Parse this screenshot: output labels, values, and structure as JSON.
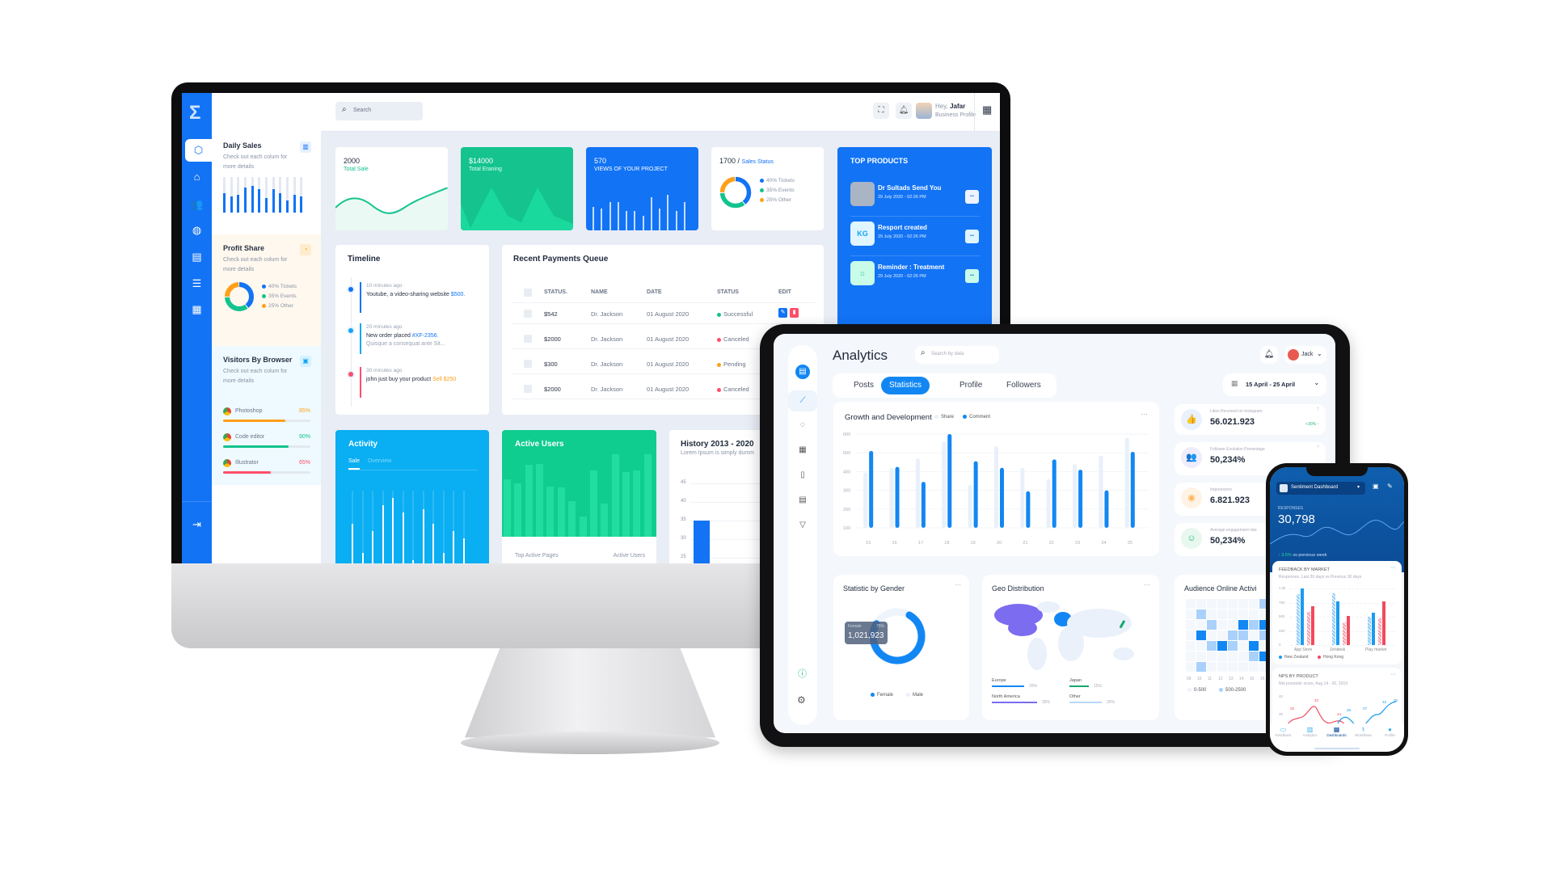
{
  "monitor": {
    "sidebar_icons": [
      "cube-icon",
      "home-icon",
      "users-icon",
      "globe-icon",
      "document-icon",
      "server-icon",
      "grid-icon"
    ],
    "logout_icon": "logout-icon",
    "search": {
      "placeholder": "Search"
    },
    "user": {
      "greeting": "Hey,",
      "name": "Jafar",
      "role": "Business Profile"
    },
    "panel": {
      "daily_sales": {
        "title": "Daily Sales",
        "desc": "Check out each colum for more details",
        "bars": [
          0.55,
          0.45,
          0.5,
          0.7,
          0.75,
          0.65,
          0.4,
          0.65,
          0.55,
          0.35,
          0.5,
          0.45
        ]
      },
      "profit_share": {
        "title": "Profit Share",
        "desc": "Check out each colum for more details",
        "legend": [
          {
            "label": "40% Tickets",
            "value": 40,
            "color": "#1273f5"
          },
          {
            "label": "35% Events",
            "value": 35,
            "color": "#14c38e"
          },
          {
            "label": "25% Other",
            "value": 25,
            "color": "#ff9f1a"
          }
        ]
      },
      "visitors": {
        "title": "Visitors By Browser",
        "desc": "Check out each colum for more details",
        "items": [
          {
            "name": "Photoshop",
            "pct": "85%",
            "value": 85,
            "color": "#ff9f1a"
          },
          {
            "name": "Code editor",
            "pct": "90%",
            "value": 90,
            "color": "#14c38e"
          },
          {
            "name": "Illustrator",
            "pct": "65%",
            "value": 65,
            "color": "#ff4d6a"
          }
        ]
      }
    },
    "cards": {
      "total_sale": {
        "value": "2000",
        "label": "Total Sale"
      },
      "total_earning": {
        "value": "$14000",
        "label": "Total Eraning"
      },
      "views": {
        "value": "570",
        "label": "VIEWS OF YOUR PROJECT",
        "bars": [
          0.5,
          0.45,
          0.6,
          0.6,
          0.4,
          0.4,
          0.3,
          0.7,
          0.45,
          0.75,
          0.4,
          0.6
        ]
      },
      "sales_status": {
        "value": "1700 /",
        "label": "Sales Status",
        "legend": [
          {
            "label": "40% Tickets",
            "value": 40,
            "color": "#1273f5"
          },
          {
            "label": "35% Events",
            "value": 35,
            "color": "#14c38e"
          },
          {
            "label": "25% Other",
            "value": 25,
            "color": "#ff9f1a"
          }
        ]
      }
    },
    "top_products": {
      "title": "TOP PRODUCTS",
      "items": [
        {
          "title": "Dr Sultads Send You",
          "date": "29 July 2020 - 02:26 PM",
          "badge": ""
        },
        {
          "title": "Resport created",
          "date": "29 July 2020 - 02:26 PM",
          "badge": "KG"
        },
        {
          "title": "Reminder : Treatment",
          "date": "29 July 2020 - 02:26 PM",
          "badge": "⌂"
        }
      ],
      "more": "•••"
    },
    "timeline": {
      "title": "Timeline",
      "items": [
        {
          "time": "10 minutes ago",
          "text": "Youtube, a video-sharing website",
          "highlight": "$500.",
          "sub": "",
          "color": "#1273f5"
        },
        {
          "time": "20 minutes ago",
          "text": "New order placed",
          "highlight": "#XF-2356.",
          "sub": "Quisque a consequat ante Sit...",
          "color": "#12a5f0"
        },
        {
          "time": "30 minutes ago",
          "text": "john just buy your product",
          "highlight": "Sell $250",
          "sub": "",
          "color": "#ff4d6a"
        }
      ]
    },
    "payments": {
      "title": "Recent Payments Queue",
      "columns": [
        "STATUS.",
        "NAME",
        "DATE",
        "STATUS",
        "EDIT"
      ],
      "rows": [
        {
          "amount": "$542",
          "name": "Dr. Jackson",
          "date": "01 August 2020",
          "status": "Successful",
          "color": "#14c38e"
        },
        {
          "amount": "$2000",
          "name": "Dr. Jackson",
          "date": "01 August 2020",
          "status": "Canceled",
          "color": "#ff4d6a"
        },
        {
          "amount": "$300",
          "name": "Dr. Jackson",
          "date": "01 August 2020",
          "status": "Pending",
          "color": "#ff9f1a"
        },
        {
          "amount": "$2000",
          "name": "Dr. Jackson",
          "date": "01 August 2020",
          "status": "Canceled",
          "color": "#ff4d6a"
        }
      ]
    },
    "activity": {
      "title": "Activity",
      "tabs": [
        "Sale",
        "Overview"
      ],
      "bars": [
        0.55,
        0.15,
        0.45,
        0.8,
        0.9,
        0.7,
        0.05,
        0.75,
        0.55,
        0.15,
        0.45,
        0.35
      ]
    },
    "active_users": {
      "title": "Active Users",
      "bars": [
        0.7,
        0.65,
        0.87,
        0.88,
        0.61,
        0.6,
        0.43,
        0.25,
        0.8,
        0.4,
        1.0,
        0.78,
        0.8,
        1.0
      ],
      "footer_left": "Top Active Pages",
      "footer_right": "Active Users"
    },
    "history": {
      "title": "History 2013 - 2020",
      "desc": "Lorem Ipsum is simply dumm",
      "yticks": [
        "45",
        "40",
        "35",
        "30",
        "25"
      ],
      "bar_value": 35
    }
  },
  "tablet": {
    "title": "Analytics",
    "search_placeholder": "Search by data",
    "user": "Jack",
    "tabs": [
      "Posts",
      "Statistics",
      "Profile",
      "Followers"
    ],
    "active_tab": "Statistics",
    "date_range": "15 April - 25 April",
    "nav_icons": [
      "chat-icon",
      "line-chart-icon",
      "messages-icon",
      "calendar-icon",
      "file-icon",
      "note-icon",
      "filter-icon"
    ],
    "growth": {
      "title": "Growth and Development",
      "legend": [
        "Share",
        "Comment"
      ],
      "colors": {
        "share": "#e8f0fb",
        "comment": "#1287f3"
      },
      "x": [
        "15",
        "16",
        "17",
        "18",
        "19",
        "20",
        "21",
        "22",
        "23",
        "24",
        "25"
      ],
      "yticks": [
        "600",
        "500",
        "400",
        "300",
        "200",
        "100"
      ],
      "ylim": [
        100,
        600
      ],
      "share": [
        395,
        420,
        470,
        560,
        330,
        535,
        420,
        360,
        440,
        485,
        580
      ],
      "comment": [
        510,
        425,
        345,
        600,
        455,
        420,
        295,
        465,
        410,
        300,
        505
      ]
    },
    "stats": [
      {
        "label": "Likes Received on Instagram",
        "value": "56.021.923",
        "delta": "+30% ↑",
        "icon": "thumbs-up-icon",
        "glyph": "👍",
        "bg": "#e8f1fd",
        "color": "#1287f3"
      },
      {
        "label": "Follower Evolution Presentage",
        "value": "50,234%",
        "delta": "",
        "icon": "users-icon",
        "glyph": "👥",
        "bg": "#efedfb",
        "color": "#7b6cf0"
      },
      {
        "label": "Impressions",
        "value": "6.821.923",
        "delta": "",
        "icon": "eye-icon",
        "glyph": "◉",
        "bg": "#fff3e6",
        "color": "#ffb35a"
      },
      {
        "label": "Average engagement rate",
        "value": "50,234%",
        "delta": "",
        "icon": "smile-icon",
        "glyph": "☺",
        "bg": "#e8f8f0",
        "color": "#20b977"
      }
    ],
    "gender": {
      "title": "Statistic by Gender",
      "tooltip_label": "Female",
      "tooltip_pct": "75%",
      "tooltip_value": "1,021,923",
      "female_share": 75,
      "legend": [
        "Female",
        "Male"
      ]
    },
    "geo": {
      "title": "Geo Distribution",
      "regions": [
        {
          "name": "Europe",
          "pct": "25%",
          "value": 25,
          "color": "#1287f3"
        },
        {
          "name": "Japan",
          "pct": "15%",
          "value": 15,
          "color": "#14a86b"
        },
        {
          "name": "North America",
          "pct": "35%",
          "value": 35,
          "color": "#7b6cf0"
        },
        {
          "name": "Other",
          "pct": "25%",
          "value": 25,
          "color": "#b9d8fb"
        }
      ]
    },
    "audience": {
      "title": "Audience Online Activi",
      "hours": [
        "09",
        "10",
        "11",
        "12",
        "13",
        "14",
        "15",
        "16"
      ],
      "legend": [
        "0-500",
        "500-2500"
      ],
      "grid": [
        [
          0,
          0,
          0,
          0,
          0,
          0,
          0,
          2
        ],
        [
          0,
          2,
          0,
          0,
          0,
          0,
          0,
          0
        ],
        [
          0,
          0,
          2,
          0,
          0,
          3,
          2,
          3
        ],
        [
          0,
          3,
          0,
          0,
          2,
          2,
          0,
          2
        ],
        [
          0,
          0,
          2,
          3,
          2,
          0,
          3,
          0
        ],
        [
          0,
          0,
          0,
          0,
          0,
          0,
          2,
          3
        ],
        [
          0,
          2,
          0,
          0,
          0,
          0,
          0,
          0
        ]
      ]
    }
  },
  "phone": {
    "dashboard": "Sentiment Dashboard",
    "responses_label": "RESPONSES",
    "responses": "30,798",
    "delta": "↑ 3.5%",
    "delta_text": "vs previous week",
    "feedback": {
      "title": "FEEDBACK BY MARKET",
      "subtitle": "Responses, Last 30 days vs Previous 30 days",
      "yticks": [
        "1.0k",
        "750",
        "500",
        "250",
        "0"
      ],
      "categories": [
        "App Store",
        "Zendesk",
        "Play market"
      ],
      "series": [
        {
          "name": "New Zealand",
          "prev": [
            900,
            920,
            500
          ],
          "curr": [
            1000,
            770,
            570
          ],
          "color": "#1a9bf0"
        },
        {
          "name": "Hong Kong",
          "prev": [
            590,
            400,
            470
          ],
          "curr": [
            680,
            510,
            770
          ],
          "color": "#f04a5e"
        }
      ]
    },
    "nps": {
      "title": "NPS BY PRODUCT",
      "subtitle": "Net promoter score, Aug 14 - 30, 2019",
      "yticks": [
        "40",
        "30"
      ],
      "red_labels": [
        "25",
        "32",
        "24",
        "20"
      ],
      "blue_labels": [
        "28",
        "27",
        "33",
        "35"
      ]
    },
    "tabs": [
      "Feedback",
      "Analytics",
      "Dashboards",
      "Workflows",
      "Profile"
    ],
    "active_tab": "Dashboards"
  }
}
